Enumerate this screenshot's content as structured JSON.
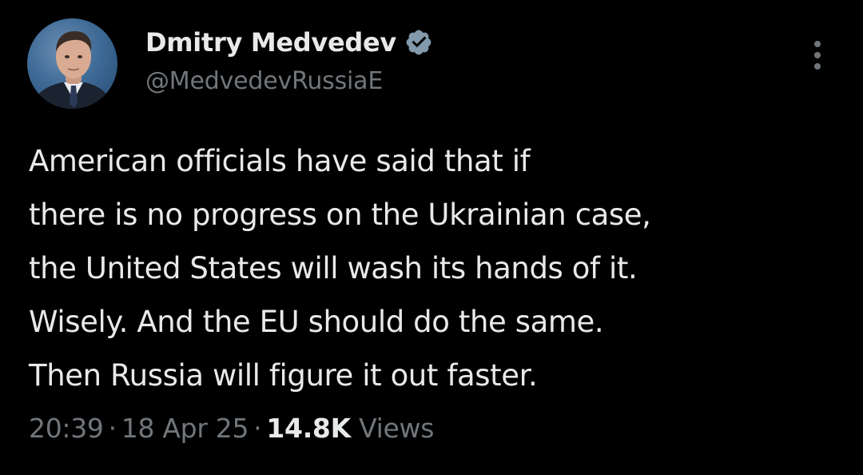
{
  "author": {
    "display_name": "Dmitry Medvedev",
    "handle": "@MedvedevRussiaE",
    "verified": true,
    "verified_badge_color": "#829aab"
  },
  "tweet": {
    "lines": [
      "American officials have said that if",
      "there is no progress on the Ukrainian case,",
      "the United States will wash its hands of it.",
      "Wisely. And the EU should do the same.",
      "Then Russia will figure it out faster."
    ]
  },
  "meta": {
    "time": "20:39",
    "separator": "·",
    "date": "18 Apr 25",
    "views_count": "14.8K",
    "views_label": "Views"
  },
  "icons": {
    "verified": "verified-badge-icon",
    "more": "more-options-icon"
  },
  "colors": {
    "background": "#000000",
    "primary_text": "#e7e9ea",
    "secondary_text": "#71767b"
  }
}
